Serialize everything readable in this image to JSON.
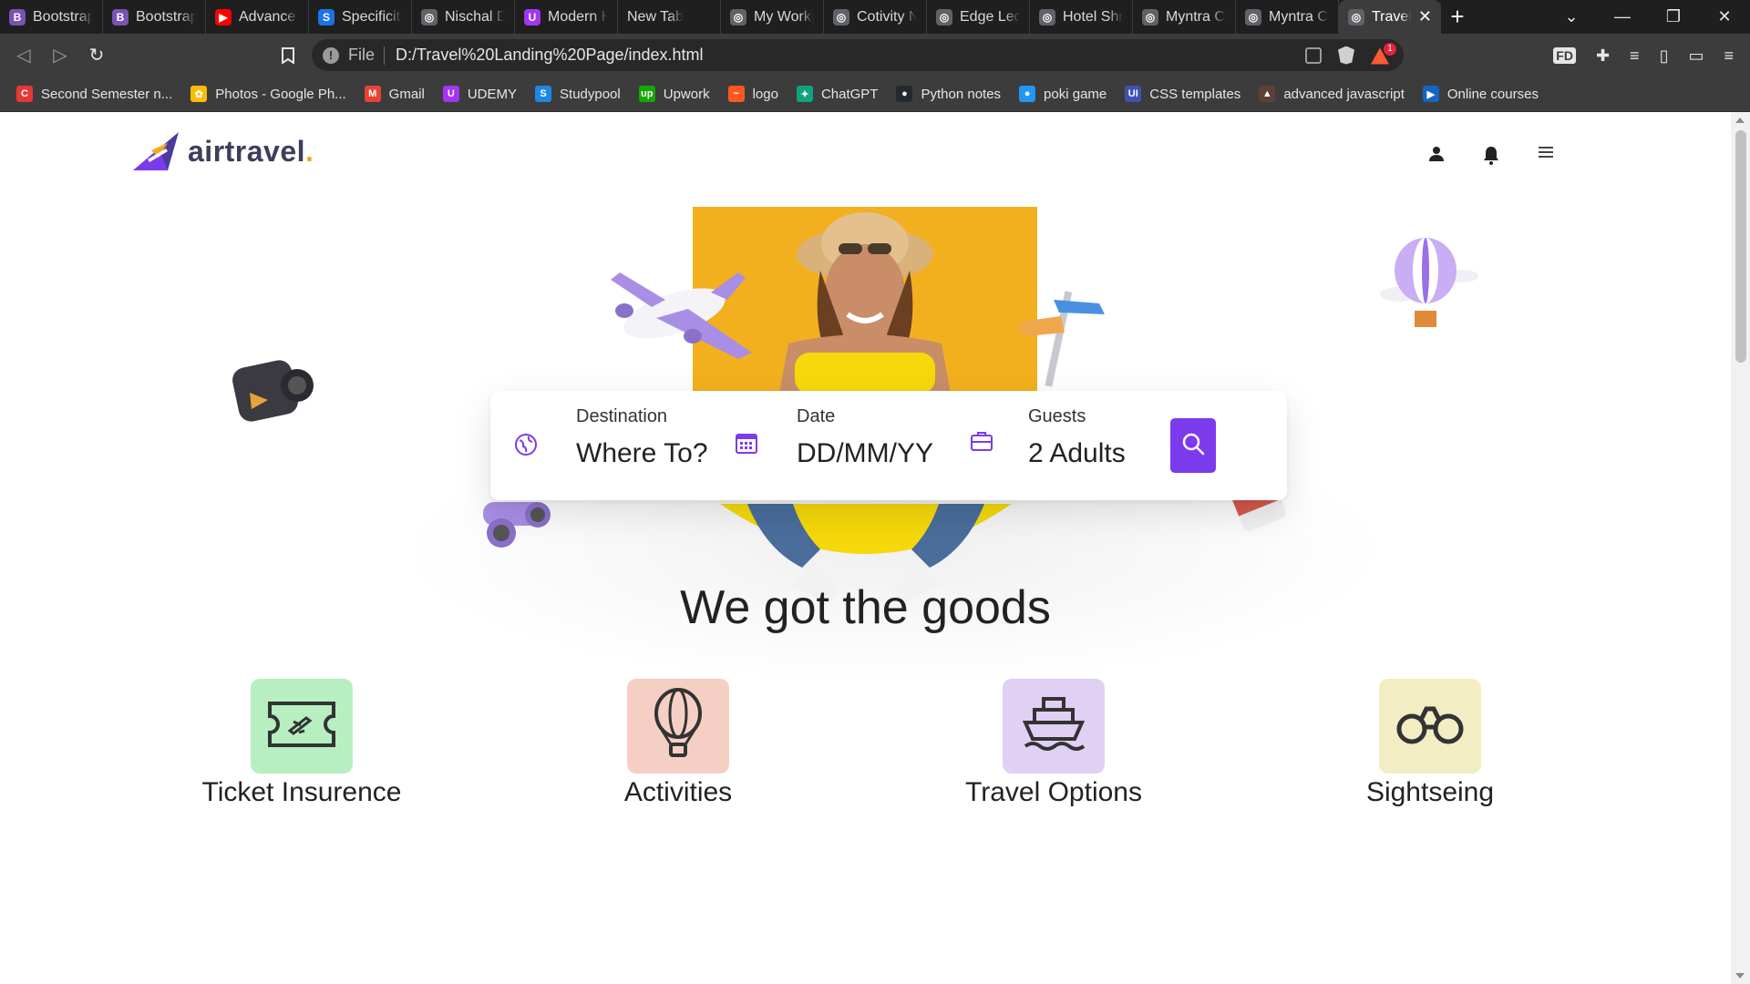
{
  "browser": {
    "tabs": [
      {
        "label": "Bootstrap",
        "icon": "bootstrap-icon",
        "color": "#7952b3",
        "glyph": "B"
      },
      {
        "label": "Bootstrap",
        "icon": "bootstrap-icon",
        "color": "#7952b3",
        "glyph": "B"
      },
      {
        "label": "Advance C",
        "icon": "youtube-icon",
        "color": "#ff0000",
        "glyph": "▶"
      },
      {
        "label": "Specificity",
        "icon": "specificity-icon",
        "color": "#1a73e8",
        "glyph": "S"
      },
      {
        "label": "Nischal Dh",
        "icon": "globe-icon",
        "color": "#5f6368",
        "glyph": "◎"
      },
      {
        "label": "Modern H",
        "icon": "udemy-icon",
        "color": "#a435f0",
        "glyph": "U"
      },
      {
        "label": "New Tab",
        "icon": "",
        "color": "#1f1f1f",
        "glyph": ""
      },
      {
        "label": "My Work|",
        "icon": "globe-icon",
        "color": "#5f6368",
        "glyph": "◎"
      },
      {
        "label": "Cotivity N",
        "icon": "globe-icon",
        "color": "#5f6368",
        "glyph": "◎"
      },
      {
        "label": "Edge Ledg",
        "icon": "globe-icon",
        "color": "#5f6368",
        "glyph": "◎"
      },
      {
        "label": "Hotel Shra",
        "icon": "globe-icon",
        "color": "#5f6368",
        "glyph": "◎"
      },
      {
        "label": "Myntra Cl",
        "icon": "globe-icon",
        "color": "#5f6368",
        "glyph": "◎"
      },
      {
        "label": "Myntra Cl",
        "icon": "globe-icon",
        "color": "#5f6368",
        "glyph": "◎"
      }
    ],
    "active_tab": {
      "label": "Travel",
      "icon": "globe-icon"
    },
    "address": {
      "scheme_label": "File",
      "url": "D:/Travel%20Landing%20Page/index.html"
    },
    "bookmarks": [
      {
        "label": "Second Semester n...",
        "color": "#e53935",
        "glyph": "C"
      },
      {
        "label": "Photos - Google Ph...",
        "color": "#fbbc04",
        "glyph": "✿"
      },
      {
        "label": "Gmail",
        "color": "#ea4335",
        "glyph": "M"
      },
      {
        "label": "UDEMY",
        "color": "#a435f0",
        "glyph": "U"
      },
      {
        "label": "Studypool",
        "color": "#1e88e5",
        "glyph": "S"
      },
      {
        "label": "Upwork",
        "color": "#14a800",
        "glyph": "up"
      },
      {
        "label": "logo",
        "color": "#ff5722",
        "glyph": "~"
      },
      {
        "label": "ChatGPT",
        "color": "#10a37f",
        "glyph": "✦"
      },
      {
        "label": "Python notes",
        "color": "#24292e",
        "glyph": "●"
      },
      {
        "label": "poki game",
        "color": "#2196f3",
        "glyph": "●"
      },
      {
        "label": "CSS templates",
        "color": "#3f51b5",
        "glyph": "UI"
      },
      {
        "label": "advanced javascript",
        "color": "#5d4037",
        "glyph": "▲"
      },
      {
        "label": "Online courses",
        "color": "#1565c0",
        "glyph": "▶"
      }
    ],
    "extensions": {
      "fd_label": "FD"
    }
  },
  "site": {
    "logo_text": "airtravel",
    "logo_dot": ".",
    "brand_color": "#7c3aed",
    "search": {
      "destination": {
        "label": "Destination",
        "value": "Where To?",
        "icon": "globe-icon"
      },
      "date": {
        "label": "Date",
        "value": "DD/MM/YY",
        "icon": "calendar-icon"
      },
      "guests": {
        "label": "Guests",
        "value": "2 Adults",
        "icon": "briefcase-icon"
      }
    },
    "section_title": "We got the goods",
    "features": [
      {
        "label": "Ticket Insurence",
        "icon": "ticket-icon",
        "bg": "#b7efc0"
      },
      {
        "label": "Activities",
        "icon": "hot-air-balloon-icon",
        "bg": "#f6cfc4"
      },
      {
        "label": "Travel Options",
        "icon": "ship-icon",
        "bg": "#e0d0f3"
      },
      {
        "label": "Sightseing",
        "icon": "binoculars-icon",
        "bg": "#f3edc4"
      }
    ]
  }
}
